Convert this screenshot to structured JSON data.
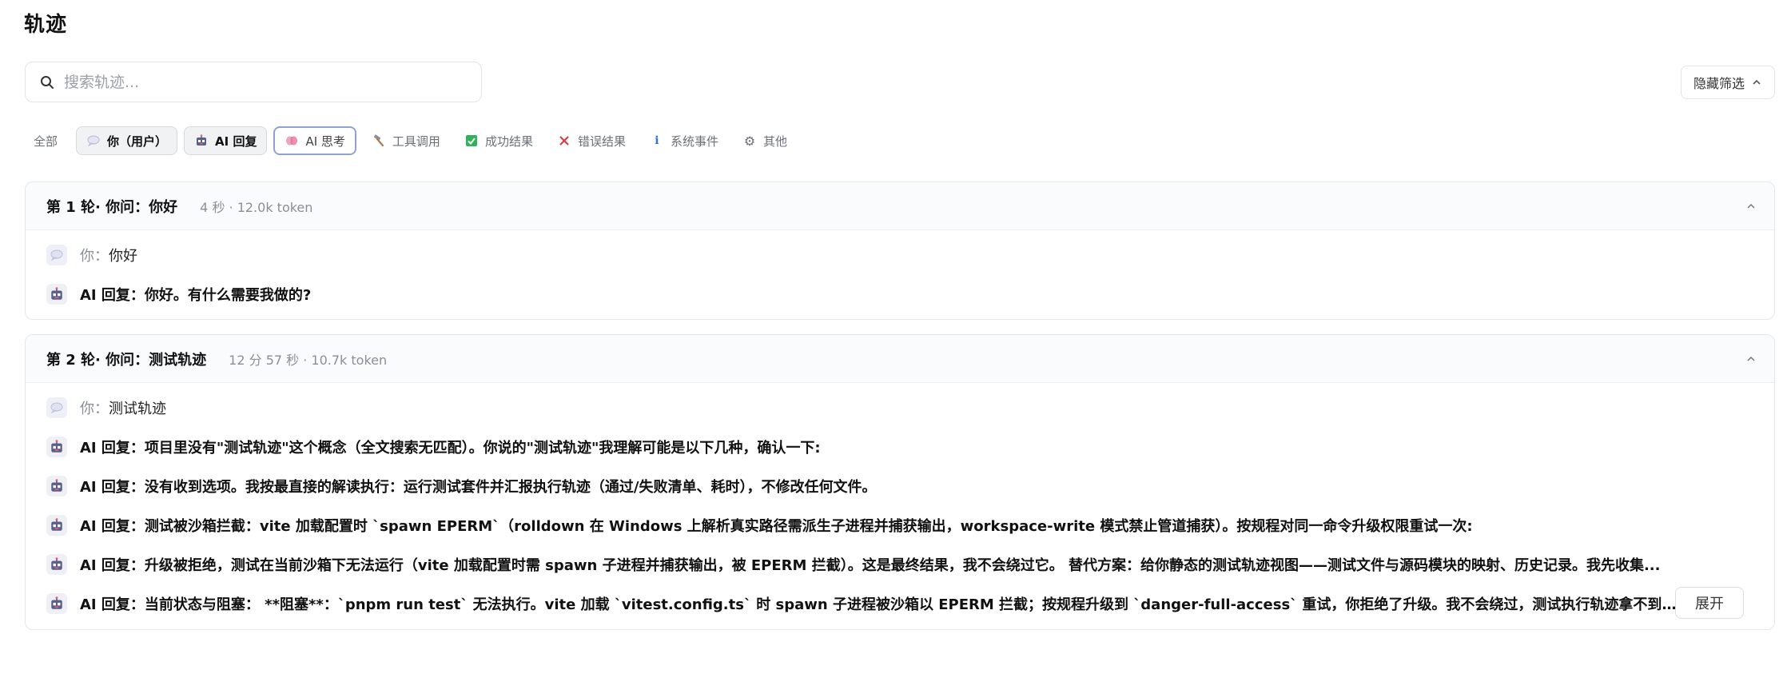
{
  "page": {
    "title": "轨迹"
  },
  "search": {
    "placeholder": "搜索轨迹..."
  },
  "filter_toggle": {
    "label": "隐藏筛选"
  },
  "filters": [
    {
      "label": "全部",
      "icon": ""
    },
    {
      "label": "你（用户）",
      "icon": "speech-bubble-icon"
    },
    {
      "label": "AI 回复",
      "icon": "robot-icon"
    },
    {
      "label": "AI 思考",
      "icon": "brain-icon"
    },
    {
      "label": "工具调用",
      "icon": "hammer-icon"
    },
    {
      "label": "成功结果",
      "icon": "check-icon"
    },
    {
      "label": "错误结果",
      "icon": "cross-icon"
    },
    {
      "label": "系统事件",
      "icon": "info-icon"
    },
    {
      "label": "其他",
      "icon": "gear-icon"
    }
  ],
  "turns": [
    {
      "title": "第 1 轮· 你问：你好",
      "meta": "4 秒 · 12.0k token",
      "messages": [
        {
          "role": "你：",
          "text": "你好"
        },
        {
          "role": "AI 回复：",
          "text": "你好。有什么需要我做的?"
        }
      ]
    },
    {
      "title": "第 2 轮· 你问：测试轨迹",
      "meta": "12 分 57 秒 · 10.7k token",
      "messages": [
        {
          "role": "你：",
          "text": "测试轨迹"
        },
        {
          "role": "AI 回复：",
          "text": "项目里没有\"测试轨迹\"这个概念（全文搜索无匹配）。你说的\"测试轨迹\"我理解可能是以下几种，确认一下:"
        },
        {
          "role": "AI 回复：",
          "text": "没有收到选项。我按最直接的解读执行：运行测试套件并汇报执行轨迹（通过/失败清单、耗时），不修改任何文件。"
        },
        {
          "role": "AI 回复：",
          "text": "测试被沙箱拦截：vite 加载配置时 `spawn EPERM`（rolldown 在 Windows 上解析真实路径需派生子进程并捕获输出，workspace-write 模式禁止管道捕获）。按规程对同一命令升级权限重试一次:"
        },
        {
          "role": "AI 回复：",
          "text": "升级被拒绝，测试在当前沙箱下无法运行（vite 加载配置时需 spawn 子进程并捕获输出，被 EPERM 拦截）。这是最终结果，我不会绕过它。 替代方案：给你静态的测试轨迹视图——测试文件与源码模块的映射、历史记录。我先收集..."
        },
        {
          "role": "AI 回复：",
          "text": "当前状态与阻塞： **阻塞**：`pnpm run test` 无法执行。vite 加载 `vitest.config.ts` 时 spawn 子进程被沙箱以 EPERM 拦截；按规程升级到 `danger-full-access` 重试，你拒绝了升级。我不会绕过，测试执行轨迹拿不到。 **..."
        }
      ],
      "expand_label": "展开"
    }
  ]
}
